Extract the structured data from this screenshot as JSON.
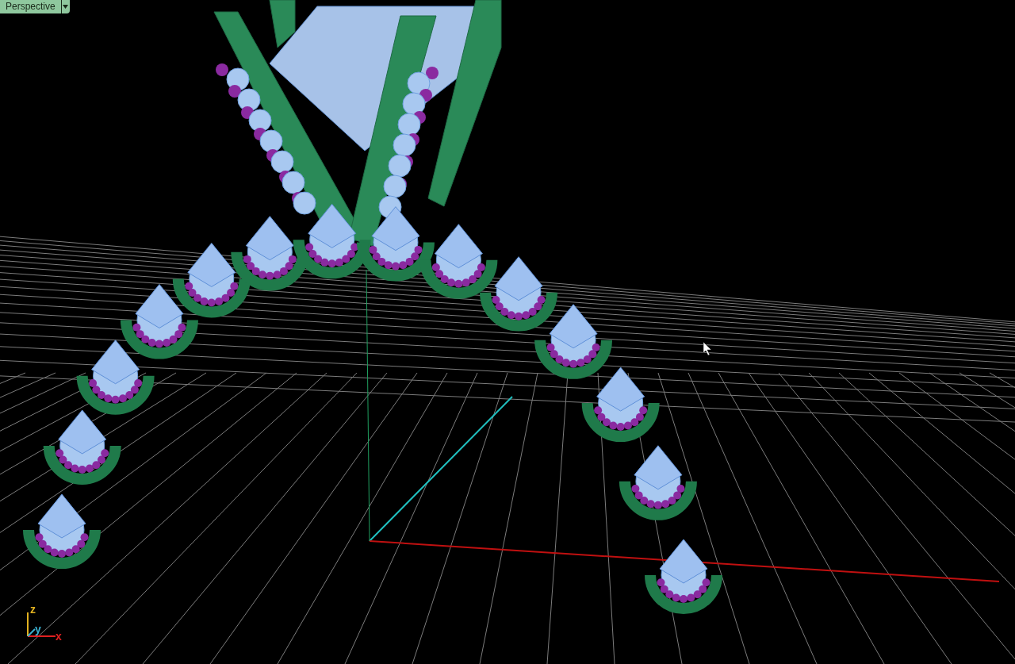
{
  "viewport": {
    "title": "Perspective"
  },
  "axis_icon": {
    "labels": [
      {
        "text": "z",
        "color": "#e0b020"
      },
      {
        "text": "y",
        "color": "#3ab0d0"
      },
      {
        "text": "x",
        "color": "#e02020"
      }
    ]
  }
}
